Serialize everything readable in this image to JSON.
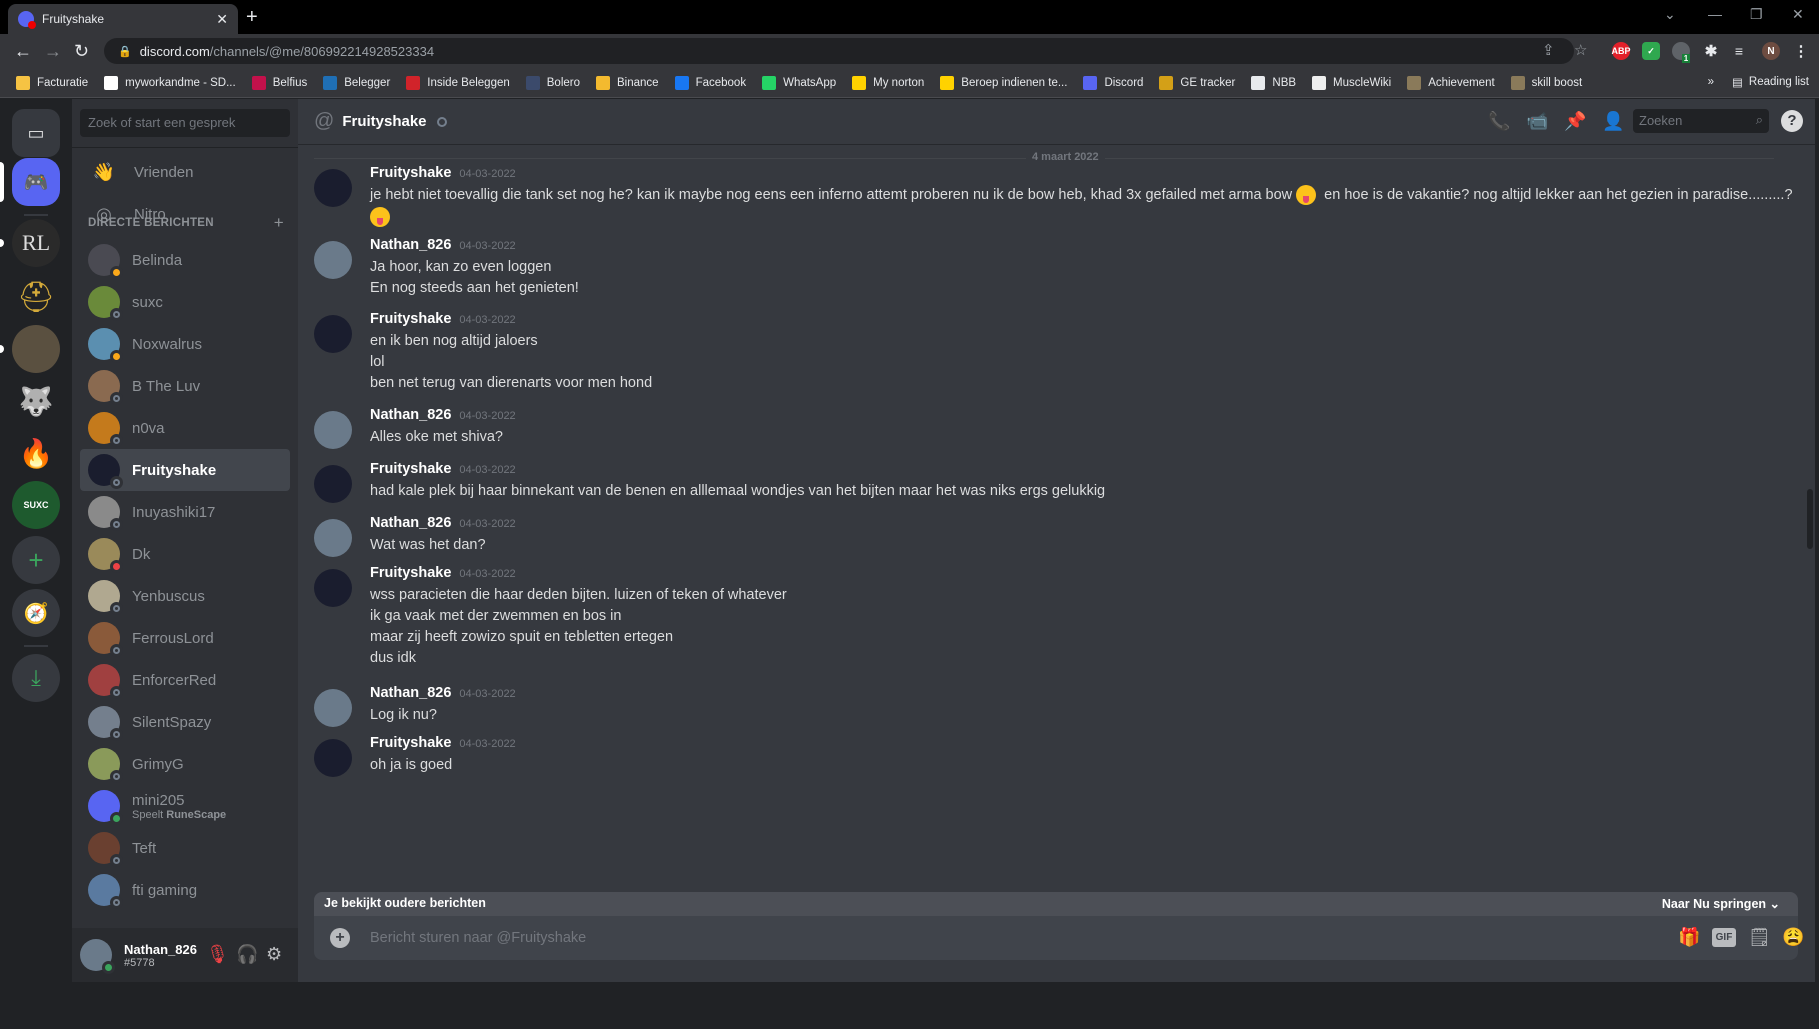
{
  "browser": {
    "tab_title": "Fruityshake",
    "url_host": "discord.com",
    "url_path": "/channels/@me/806992214928523334",
    "profile_initial": "N",
    "ext_badge": "1",
    "bookmarks": [
      {
        "label": "Facturatie",
        "color": "#f6c343"
      },
      {
        "label": "myworkandme - SD...",
        "color": "#ffffff"
      },
      {
        "label": "Belfius",
        "color": "#c3114b"
      },
      {
        "label": "Belegger",
        "color": "#1f6fb5"
      },
      {
        "label": "Inside Beleggen",
        "color": "#d1232a"
      },
      {
        "label": "Bolero",
        "color": "#3b4a6b"
      },
      {
        "label": "Binance",
        "color": "#f3ba2f"
      },
      {
        "label": "Facebook",
        "color": "#1877f2"
      },
      {
        "label": "WhatsApp",
        "color": "#25d366"
      },
      {
        "label": "My norton",
        "color": "#ffd200"
      },
      {
        "label": "Beroep indienen te...",
        "color": "#ffd200"
      },
      {
        "label": "Discord",
        "color": "#5865f2"
      },
      {
        "label": "GE tracker",
        "color": "#d4a017"
      },
      {
        "label": "NBB",
        "color": "#e8eaed"
      },
      {
        "label": "MuscleWiki",
        "color": "#eeeeee"
      },
      {
        "label": "Achievement",
        "color": "#8a7a5a"
      },
      {
        "label": "skill boost",
        "color": "#8a7a5a"
      }
    ],
    "reading_list": "Reading list",
    "more_bookmarks": "»"
  },
  "sidebar": {
    "search_placeholder": "Zoek of start een gesprek",
    "nav": [
      {
        "label": "Vrienden",
        "icon": "friends-icon"
      },
      {
        "label": "Nitro",
        "icon": "nitro-icon"
      }
    ],
    "section_title": "DIRECTE BERICHTEN",
    "dms": [
      {
        "name": "Belinda",
        "status": "idle",
        "color": "#4a4a52"
      },
      {
        "name": "suxc",
        "status": "offline",
        "color": "#6a8a3a"
      },
      {
        "name": "Noxwalrus",
        "status": "idle",
        "color": "#5b8fb0"
      },
      {
        "name": "B The Luv",
        "status": "offline",
        "color": "#8a6a50"
      },
      {
        "name": "n0va",
        "status": "offline",
        "color": "#c47a1c"
      },
      {
        "name": "Fruityshake",
        "status": "offline",
        "color": "#1a1d2e",
        "active": true
      },
      {
        "name": "Inuyashiki17",
        "status": "offline",
        "color": "#8a8a8a"
      },
      {
        "name": "Dk",
        "status": "dnd",
        "color": "#9a8a5a"
      },
      {
        "name": "Yenbuscus",
        "status": "offline",
        "color": "#b0a890"
      },
      {
        "name": "FerrousLord",
        "status": "offline",
        "color": "#8a5a3a"
      },
      {
        "name": "EnforcerRed",
        "status": "offline",
        "color": "#a04040"
      },
      {
        "name": "SilentSpazy",
        "status": "offline",
        "color": "#747f8d"
      },
      {
        "name": "GrimyG",
        "status": "offline",
        "color": "#8a9a5a"
      },
      {
        "name": "mini205",
        "status": "online",
        "color": "#5865f2",
        "sub_prefix": "Speelt ",
        "sub_game": "RuneScape"
      },
      {
        "name": "Teft",
        "status": "offline",
        "color": "#6a4030"
      },
      {
        "name": "fti gaming",
        "status": "offline",
        "color": "#5a7aa0"
      }
    ],
    "user": {
      "name": "Nathan_826",
      "tag": "#5778"
    }
  },
  "servers": [
    {
      "name": "home",
      "color": "#5865f2"
    },
    {
      "name": "RL",
      "color": "#2a2a2a",
      "label": "RL"
    },
    {
      "name": "helmet",
      "color": "#202225"
    },
    {
      "name": "armor",
      "color": "#4a4030"
    },
    {
      "name": "wolf",
      "color": "#202225"
    },
    {
      "name": "flame",
      "color": "#202225"
    },
    {
      "name": "SUXC",
      "color": "#1e5a2e",
      "label": "SUXC"
    }
  ],
  "chat": {
    "title": "Fruityshake",
    "search_placeholder": "Zoeken",
    "date_divider": "4 maart 2022",
    "messages": [
      {
        "author": "Fruityshake",
        "time": "04-03-2022",
        "lines": [
          "je hebt niet toevallig die tank set nog he? kan ik maybe nog eens een inferno attemt proberen nu ik de bow heb, khad 3x gefailed met arma bow",
          " en hoe is de vakantie? nog altijd lekker aan het gezien in paradise.........?"
        ]
      },
      {
        "author": "Nathan_826",
        "time": "04-03-2022",
        "lines": [
          "Ja hoor, kan zo even loggen",
          "En nog steeds aan het genieten!"
        ]
      },
      {
        "author": "Fruityshake",
        "time": "04-03-2022",
        "lines": [
          "en ik ben nog altijd jaloers",
          "lol",
          "ben net terug van dierenarts voor men hond"
        ]
      },
      {
        "author": "Nathan_826",
        "time": "04-03-2022",
        "lines": [
          "Alles oke met shiva?"
        ]
      },
      {
        "author": "Fruityshake",
        "time": "04-03-2022",
        "lines": [
          "had kale plek bij haar binnekant van de benen en alllemaal wondjes van het bijten maar het was niks ergs gelukkig"
        ]
      },
      {
        "author": "Nathan_826",
        "time": "04-03-2022",
        "lines": [
          "Wat was het dan?"
        ]
      },
      {
        "author": "Fruityshake",
        "time": "04-03-2022",
        "lines": [
          "wss paracieten die haar deden bijten. luizen of teken of whatever",
          "ik ga vaak met der zwemmen en bos in",
          "maar zij heeft zowizo spuit en tebletten ertegen",
          "dus idk"
        ]
      },
      {
        "author": "Nathan_826",
        "time": "04-03-2022",
        "lines": [
          "Log ik nu?"
        ]
      },
      {
        "author": "Fruityshake",
        "time": "04-03-2022",
        "lines": [
          "oh ja is goed"
        ]
      }
    ],
    "older_notice": "Je bekijkt oudere berichten",
    "jump_label": "Naar Nu springen",
    "input_placeholder": "Bericht sturen naar @Fruityshake",
    "gif_label": "GIF"
  }
}
